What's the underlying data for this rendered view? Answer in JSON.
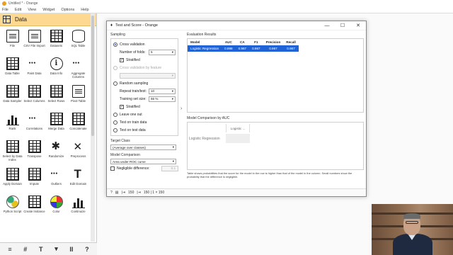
{
  "app": {
    "title": "Untitled * - Orange"
  },
  "menu": [
    "File",
    "Edit",
    "View",
    "Widget",
    "Options",
    "Help"
  ],
  "panel": {
    "category": "Data",
    "widgets": [
      {
        "label": "File",
        "icon": "doc"
      },
      {
        "label": "CSV File Import",
        "icon": "doc"
      },
      {
        "label": "Datasets",
        "icon": "table"
      },
      {
        "label": "SQL Table",
        "icon": "db"
      },
      {
        "label": "Data Table",
        "icon": "table"
      },
      {
        "label": "Paint Data",
        "icon": "dots"
      },
      {
        "label": "Data Info",
        "icon": "info"
      },
      {
        "label": "Aggregate Columns",
        "icon": "dots"
      },
      {
        "label": "Data Sampler",
        "icon": "table"
      },
      {
        "label": "Select Columns",
        "icon": "table"
      },
      {
        "label": "Select Rows",
        "icon": "table"
      },
      {
        "label": "Pivot Table",
        "icon": "doc"
      },
      {
        "label": "Rank",
        "icon": "bars"
      },
      {
        "label": "Correlations",
        "icon": "dots"
      },
      {
        "label": "Merge Data",
        "icon": "table"
      },
      {
        "label": "Concatenate",
        "icon": "table"
      },
      {
        "label": "Select by Data Index",
        "icon": "table"
      },
      {
        "label": "Transpose",
        "icon": "table"
      },
      {
        "label": "Randomize",
        "icon": "star"
      },
      {
        "label": "Preprocess",
        "icon": "cross"
      },
      {
        "label": "Apply Domain",
        "icon": "table"
      },
      {
        "label": "Impute",
        "icon": "table"
      },
      {
        "label": "Outliers",
        "icon": "dots"
      },
      {
        "label": "Edit Domain",
        "icon": "text"
      },
      {
        "label": "Python Script",
        "icon": "python"
      },
      {
        "label": "Create Instance",
        "icon": "table"
      },
      {
        "label": "Color",
        "icon": "palette"
      },
      {
        "label": "Continuize",
        "icon": "bars"
      }
    ],
    "toolbar": [
      "≡",
      "#",
      "T",
      "▾",
      "II",
      "?"
    ]
  },
  "dialog": {
    "title": "Test and Score - Orange",
    "sampling_label": "Sampling",
    "cross_validation": "Cross validation",
    "num_folds_label": "Number of folds:",
    "num_folds_value": "5",
    "stratified": "Stratified",
    "cv_by_feature": "Cross validation by feature",
    "random_sampling": "Random sampling",
    "repeat_label": "Repeat train/test:",
    "repeat_value": "10",
    "train_size_label": "Training set size:",
    "train_size_value": "66 %",
    "stratified2": "Stratified",
    "leave_one_out": "Leave one out",
    "test_on_train": "Test on train data",
    "test_on_test": "Test on test data",
    "target_class_label": "Target Class",
    "target_class_value": "(Average over classes)",
    "model_comparison_label": "Model Comparison",
    "model_comparison_value": "Area under ROC curve",
    "negligible_label": "Negligible difference:",
    "negligible_value": "0.1",
    "eval_results_label": "Evaluation Results",
    "eval_table": {
      "headers": [
        "Model",
        "AUC",
        "CA",
        "F1",
        "Precision",
        "Recall"
      ],
      "rows": [
        [
          "Logistic Regression",
          "0.998",
          "0.967",
          "0.967",
          "0.967",
          "0.967"
        ]
      ]
    },
    "model_comparison_box_label": "Model Comparison by AUC",
    "cmp_col_header": "Logistic ...",
    "cmp_row_header": "Logistic Regression",
    "note": "Table shows probabilities that the score for the model in the row is higher than that of the model in the column. Small numbers show the probability that the difference is negligible.",
    "status_in": "150",
    "status_out": "150 | 1 × 150"
  }
}
